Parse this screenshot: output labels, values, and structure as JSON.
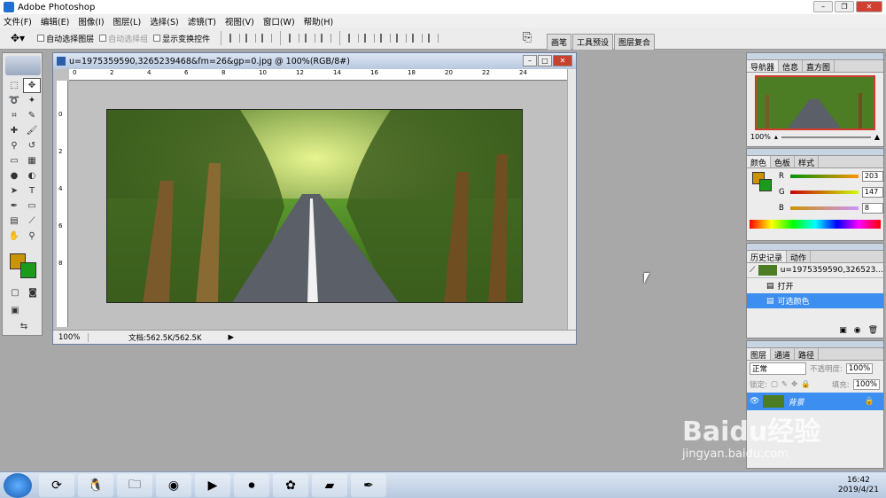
{
  "window": {
    "title": "Adobe Photoshop"
  },
  "menu": [
    "文件(F)",
    "编辑(E)",
    "图像(I)",
    "图层(L)",
    "选择(S)",
    "滤镜(T)",
    "视图(V)",
    "窗口(W)",
    "帮助(H)"
  ],
  "options": {
    "auto_select_layer": "自动选择图层",
    "auto_select_group": "自动选择组",
    "show_transform": "显示变换控件"
  },
  "palette_well": [
    "画笔",
    "工具预设",
    "图层复合"
  ],
  "document": {
    "title": "u=1975359590,3265239468&fm=26&gp=0.jpg @ 100%(RGB/8#)",
    "zoom": "100%",
    "docsize": "文档:562.5K/562.5K",
    "ruler_top": [
      "0",
      "2",
      "4",
      "6",
      "8",
      "10",
      "12",
      "14",
      "16",
      "18",
      "20",
      "22",
      "24"
    ],
    "ruler_left": [
      "0",
      "2",
      "4",
      "6",
      "8"
    ]
  },
  "navigator": {
    "tabs": [
      "导航器",
      "信息",
      "直方图"
    ],
    "zoom": "100%"
  },
  "color_panel": {
    "tabs": [
      "颜色",
      "色板",
      "样式"
    ],
    "fg": "#cb9308",
    "bg": "#1a9c1a",
    "r_label": "R",
    "r": "203",
    "g_label": "G",
    "g": "147",
    "b_label": "B",
    "b": "8"
  },
  "history": {
    "tabs": [
      "历史记录",
      "动作"
    ],
    "snapshot": "u=1975359590,326523...",
    "items": [
      "打开",
      "可选颜色"
    ]
  },
  "layers": {
    "tabs": [
      "图层",
      "通道",
      "路径"
    ],
    "blend": "正常",
    "opacity_label": "不透明度:",
    "opacity": "100%",
    "lock_label": "锁定:",
    "fill_label": "填充:",
    "fill": "100%",
    "layer_name": "背景"
  },
  "taskbar": {
    "time": "16:42",
    "date": "2019/4/21"
  },
  "watermark": {
    "brand": "Baidu经验",
    "url": "jingyan.baidu.com"
  }
}
